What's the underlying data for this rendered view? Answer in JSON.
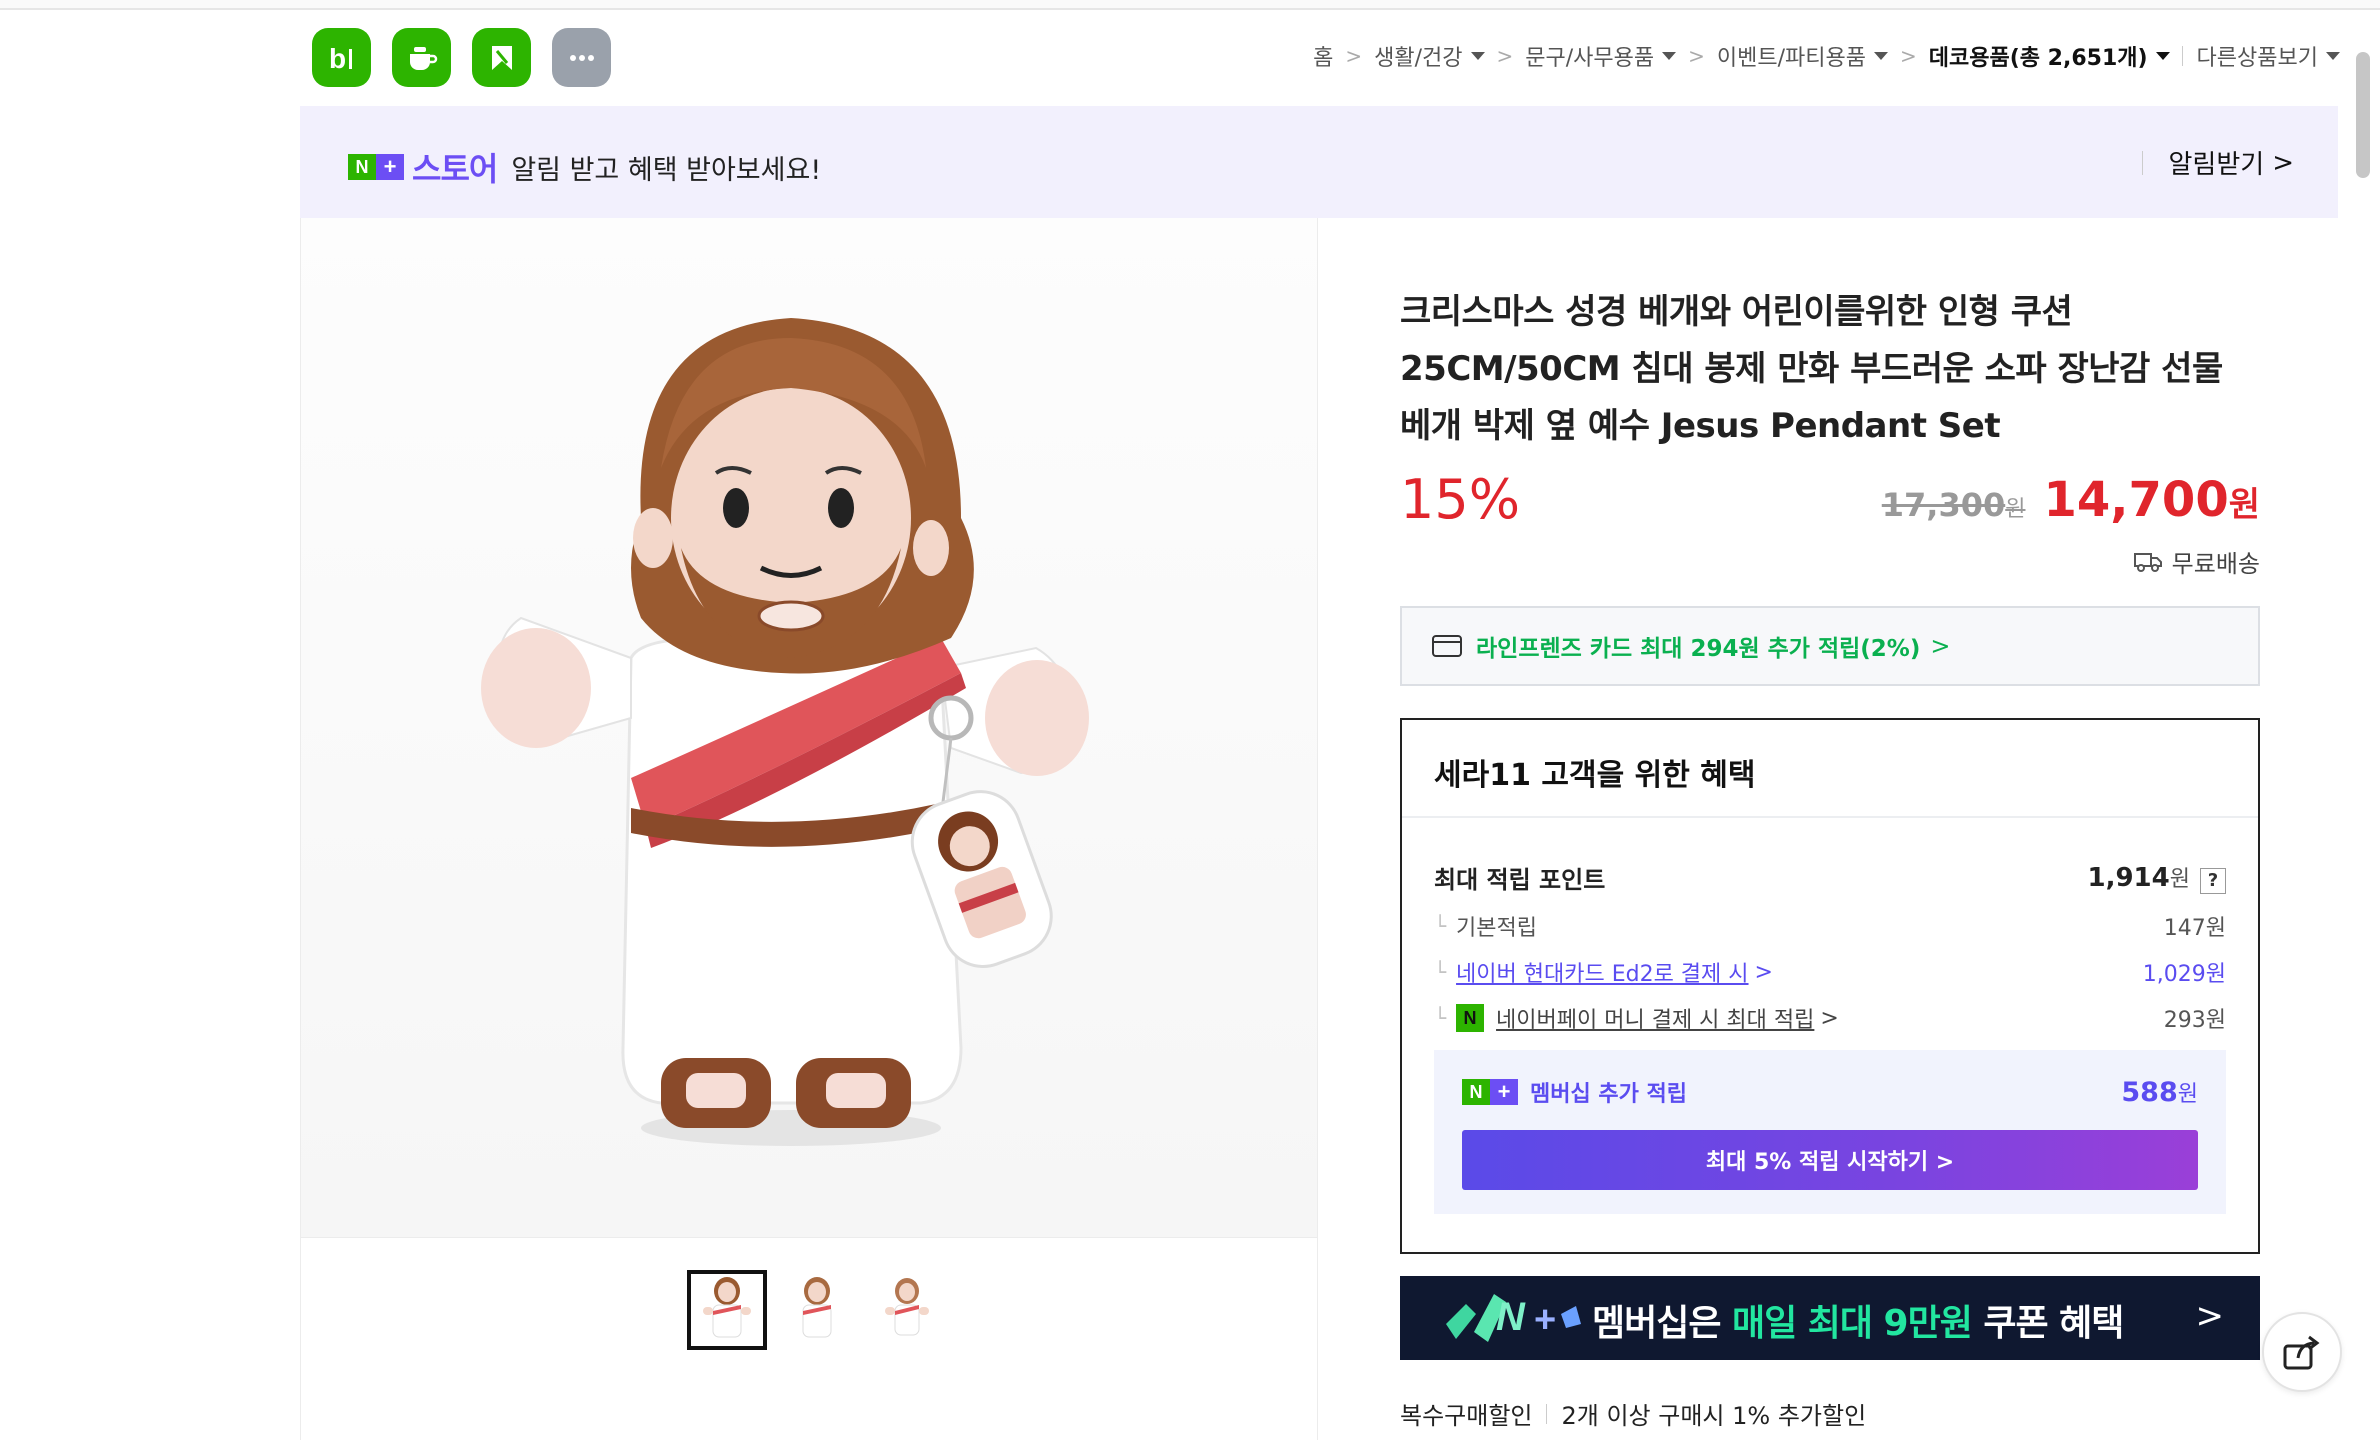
{
  "header": {
    "apps": [
      {
        "name": "blog-icon"
      },
      {
        "name": "cafe-icon"
      },
      {
        "name": "pay-icon"
      },
      {
        "name": "more-icon"
      }
    ],
    "breadcrumb": {
      "home": "홈",
      "cat1": "생활/건강",
      "cat2": "문구/사무용품",
      "cat3": "이벤트/파티용품",
      "cat4": "데코용품(총 2,651개)",
      "more": "다른상품보기",
      "separator": ">"
    }
  },
  "promo": {
    "badge_n": "N",
    "badge_plus": "+",
    "brand": "스토어",
    "message": "알림 받고 혜택 받아보세요!",
    "notify_label": "알림받기",
    "chevron": ">"
  },
  "product": {
    "title": "크리스마스 성경 베개와 어린이를위한 인형 쿠션 25CM/50CM 침대 봉제 만화 부드러운 소파 장난감 선물 베개 박제 옆 예수 Jesus Pendant Set",
    "discount": "15%",
    "original_price": "17,300",
    "original_unit": "원",
    "sale_price": "14,700",
    "sale_unit": "원",
    "shipping": "무료배송",
    "card_offer": "라인프렌즈 카드 최대 294원 추가 적립(2%)",
    "chevron": ">"
  },
  "benefit": {
    "title": "세라11 고객을 위한 혜택",
    "max_points_label": "최대 적립 포인트",
    "max_points_value": "1,914",
    "max_points_unit": "원",
    "help": "?",
    "rows": [
      {
        "label": "기본적립",
        "value": "147원"
      },
      {
        "label": "네이버 현대카드 Ed2로 결제 시",
        "value": "1,029원"
      },
      {
        "label": "네이버페이 머니 결제 시 최대 적립",
        "value": "293원"
      }
    ],
    "npay_badge": "N",
    "tree_mark": "└",
    "member_label": "멤버십 추가 적립",
    "member_value": "588",
    "member_unit": "원",
    "member_cta": "최대 5% 적립 시작하기 >"
  },
  "member_banner": {
    "text_a": "멤버십은 ",
    "text_highlight": "매일 최대 9만원",
    "text_b": " 쿠폰 혜택",
    "chevron": ">"
  },
  "multi_buy": {
    "label": "복수구매할인",
    "text": "2개 이상 구매시 1% 추가할인"
  },
  "thumbnails": [
    {
      "selected": true
    },
    {
      "selected": false
    },
    {
      "selected": false
    }
  ],
  "colors": {
    "naver_green": "#2db400",
    "discount_red": "#e0252c",
    "accent_purple": "#5a4cf0",
    "card_green": "#0ab04f"
  }
}
